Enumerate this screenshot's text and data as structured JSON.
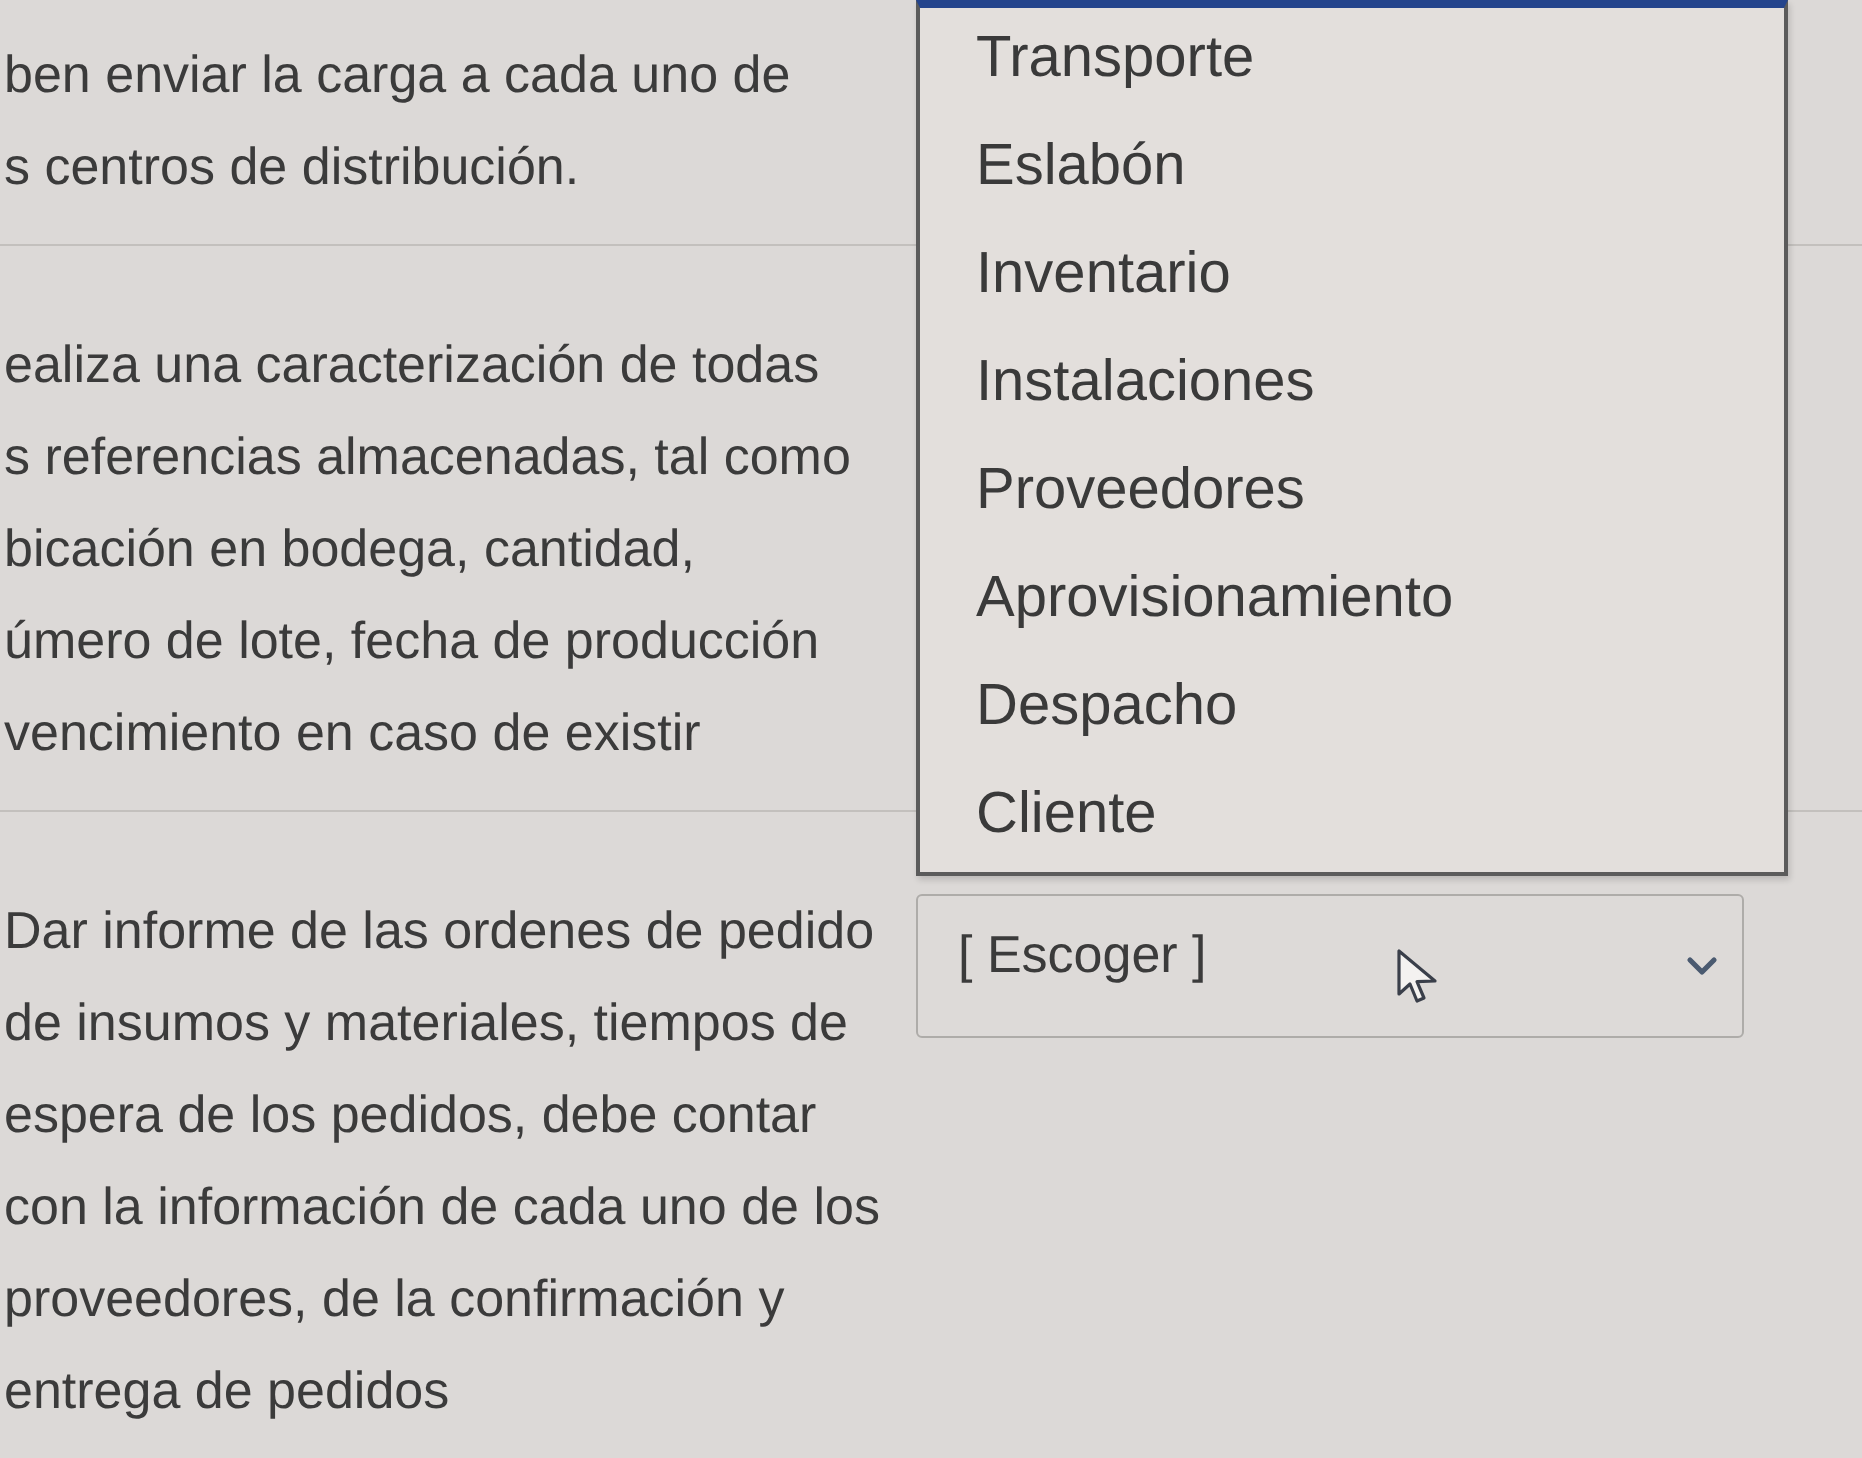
{
  "questions": [
    {
      "lines": [
        "ben enviar la carga a cada uno de",
        "s centros de distribución."
      ]
    },
    {
      "lines": [
        "ealiza una caracterización de todas",
        "s referencias almacenadas, tal como",
        "bicación en bodega, cantidad,",
        "úmero de lote, fecha de producción",
        "vencimiento en caso de existir"
      ]
    },
    {
      "lines": [
        "Dar informe de las ordenes de pedido",
        "de insumos y materiales, tiempos de",
        "espera de los pedidos, debe contar",
        "con la información de cada uno de los",
        "proveedores, de la confirmación y",
        "entrega de pedidos"
      ],
      "answer": {
        "value": "[ Escoger ]"
      }
    }
  ],
  "dropdown_menu": {
    "options": [
      {
        "label": "Transporte",
        "selected": false
      },
      {
        "label": "Eslabón",
        "selected": false
      },
      {
        "label": "Inventario",
        "selected": false
      },
      {
        "label": "Instalaciones",
        "selected": false
      },
      {
        "label": "Proveedores",
        "selected": false
      },
      {
        "label": "Aprovisionamiento",
        "selected": false
      },
      {
        "label": "Despacho",
        "selected": false
      },
      {
        "label": "Cliente",
        "selected": false
      }
    ]
  }
}
